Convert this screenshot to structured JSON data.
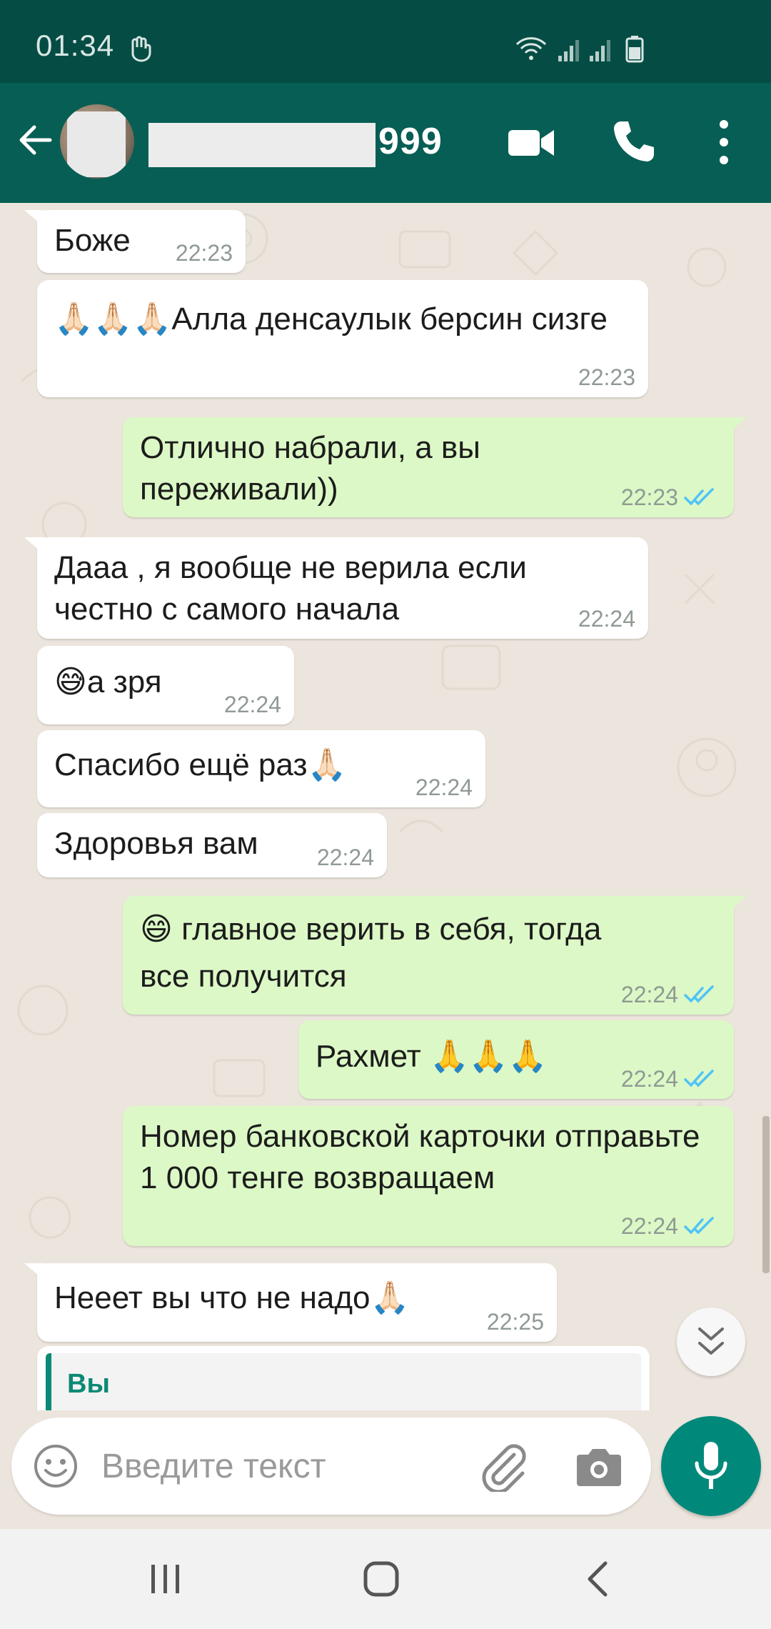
{
  "status_bar": {
    "time": "01:34"
  },
  "header": {
    "contact_name_suffix": "999"
  },
  "messages": [
    {
      "direction": "in",
      "text": "Боже",
      "time": "22:23"
    },
    {
      "direction": "in",
      "text": "🙏🏻🙏🏻🙏🏻Алла денсаулык берсин сизге",
      "time": "22:23"
    },
    {
      "direction": "out",
      "text": "Отлично набрали, а вы переживали))",
      "time": "22:23",
      "status": "read"
    },
    {
      "direction": "in",
      "text": "Дааа , я вообще не верила если честно с самого начала",
      "time": "22:24"
    },
    {
      "direction": "in",
      "text": "😅а зря",
      "time": "22:24"
    },
    {
      "direction": "in",
      "text": "Спасибо ещё раз🙏🏻",
      "time": "22:24"
    },
    {
      "direction": "in",
      "text": "Здоровья вам",
      "time": "22:24"
    },
    {
      "direction": "out",
      "text": "😄 главное верить в себя, тогда все получится",
      "time": "22:24",
      "status": "read"
    },
    {
      "direction": "out",
      "text": "Рахмет 🙏🙏🙏",
      "time": "22:24",
      "status": "read"
    },
    {
      "direction": "out",
      "text": "Номер банковской карточки отправьте 1 000 тенге возвращаем",
      "time": "22:24",
      "status": "read"
    },
    {
      "direction": "in",
      "text": "Нееет вы что не надо🙏🏻",
      "time": "22:25"
    }
  ],
  "quoted_reply": {
    "author": "Вы"
  },
  "input": {
    "placeholder": "Введите текст"
  },
  "icons": {
    "header": [
      "back-arrow-icon",
      "video-call-icon",
      "phone-icon",
      "more-vertical-icon"
    ],
    "input": [
      "emoji-icon",
      "attach-icon",
      "camera-icon",
      "mic-icon"
    ],
    "nav": [
      "recent-apps-icon",
      "home-icon",
      "back-icon"
    ]
  },
  "colors": {
    "header": "#075e54",
    "status_bar": "#054d44",
    "outgoing_bubble": "#dcf8c6",
    "incoming_bubble": "#ffffff",
    "read_ticks": "#4fc3f7",
    "accent": "#00897b"
  }
}
